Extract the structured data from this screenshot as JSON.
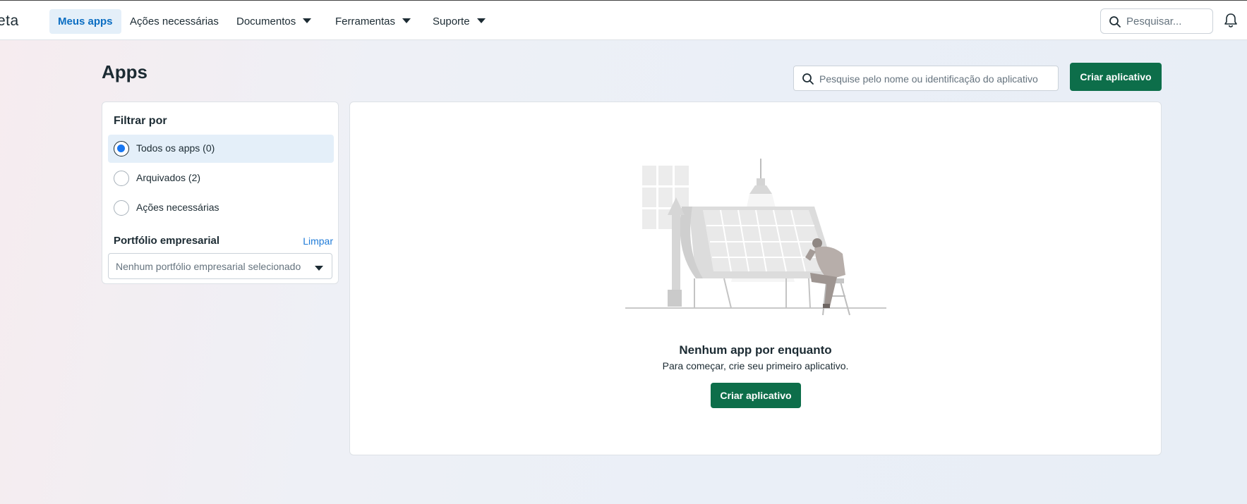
{
  "header": {
    "logo": "eta",
    "nav": {
      "my_apps": "Meus apps",
      "actions": "Ações necessárias",
      "documents": "Documentos",
      "tools": "Ferramentas",
      "support": "Suporte"
    },
    "search_placeholder": "Pesquisar..."
  },
  "page": {
    "title": "Apps",
    "search_placeholder": "Pesquise pelo nome ou identificação do aplicativo",
    "create_button": "Criar aplicativo"
  },
  "filters": {
    "title": "Filtrar por",
    "options": [
      {
        "label": "Todos os apps (0)",
        "selected": true
      },
      {
        "label": "Arquivados (2)",
        "selected": false
      },
      {
        "label": "Ações necessárias",
        "selected": false
      }
    ],
    "portfolio_title": "Portfólio empresarial",
    "clear_label": "Limpar",
    "portfolio_placeholder": "Nenhum portfólio empresarial selecionado"
  },
  "empty_state": {
    "title": "Nenhum app por enquanto",
    "subtitle": "Para começar, crie seu primeiro aplicativo.",
    "button": "Criar aplicativo"
  },
  "colors": {
    "accent": "#0d6e4a",
    "link": "#1f7bd8",
    "active_nav_bg": "#e4eff9"
  }
}
